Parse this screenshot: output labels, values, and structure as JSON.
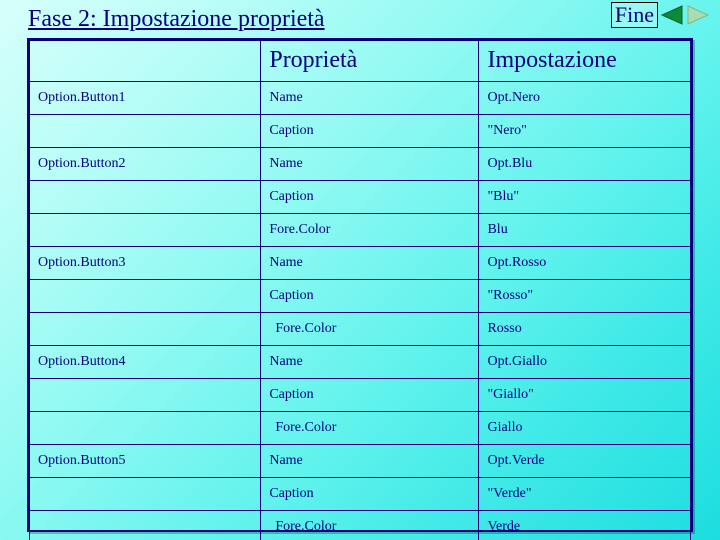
{
  "title": "Fase 2: Impostazione proprietà",
  "fine_label": "Fine",
  "nav": {
    "back_icon": "triangle-left",
    "fwd_icon": "triangle-right"
  },
  "headers": {
    "col1": "",
    "col2": "Proprietà",
    "col3": "Impostazione"
  },
  "rows": [
    {
      "object": "Option.Button1",
      "property": "Name",
      "value": "Opt.Nero",
      "indent": false
    },
    {
      "object": "",
      "property": "Caption",
      "value": "\"Nero\"",
      "indent": false
    },
    {
      "object": "Option.Button2",
      "property": "Name",
      "value": "Opt.Blu",
      "indent": false
    },
    {
      "object": "",
      "property": "Caption",
      "value": "\"Blu\"",
      "indent": false
    },
    {
      "object": "",
      "property": "Fore.Color",
      "value": "Blu",
      "indent": false
    },
    {
      "object": "Option.Button3",
      "property": "Name",
      "value": "Opt.Rosso",
      "indent": false
    },
    {
      "object": "",
      "property": "Caption",
      "value": "\"Rosso\"",
      "indent": false
    },
    {
      "object": "",
      "property": "Fore.Color",
      "value": "Rosso",
      "indent": true
    },
    {
      "object": "Option.Button4",
      "property": "Name",
      "value": "Opt.Giallo",
      "indent": false
    },
    {
      "object": "",
      "property": "Caption",
      "value": "\"Giallo\"",
      "indent": false
    },
    {
      "object": "",
      "property": "Fore.Color",
      "value": "Giallo",
      "indent": true
    },
    {
      "object": "Option.Button5",
      "property": "Name",
      "value": "Opt.Verde",
      "indent": false
    },
    {
      "object": "",
      "property": "Caption",
      "value": "\"Verde\"",
      "indent": false
    },
    {
      "object": "",
      "property": "Fore.Color",
      "value": "Verde",
      "indent": true
    }
  ],
  "colors": {
    "nav_back": "#0b8a3a",
    "nav_fwd": "#a0d8a0"
  },
  "chart_data": {
    "type": "table",
    "title": "Fase 2: Impostazione proprietà",
    "columns": [
      "",
      "Proprietà",
      "Impostazione"
    ],
    "data": [
      [
        "Option.Button1",
        "Name",
        "Opt.Nero"
      ],
      [
        "",
        "Caption",
        "\"Nero\""
      ],
      [
        "Option.Button2",
        "Name",
        "Opt.Blu"
      ],
      [
        "",
        "Caption",
        "\"Blu\""
      ],
      [
        "",
        "Fore.Color",
        "Blu"
      ],
      [
        "Option.Button3",
        "Name",
        "Opt.Rosso"
      ],
      [
        "",
        "Caption",
        "\"Rosso\""
      ],
      [
        "",
        "Fore.Color",
        "Rosso"
      ],
      [
        "Option.Button4",
        "Name",
        "Opt.Giallo"
      ],
      [
        "",
        "Caption",
        "\"Giallo\""
      ],
      [
        "",
        "Fore.Color",
        "Giallo"
      ],
      [
        "Option.Button5",
        "Name",
        "Opt.Verde"
      ],
      [
        "",
        "Caption",
        "\"Verde\""
      ],
      [
        "",
        "Fore.Color",
        "Verde"
      ]
    ]
  }
}
